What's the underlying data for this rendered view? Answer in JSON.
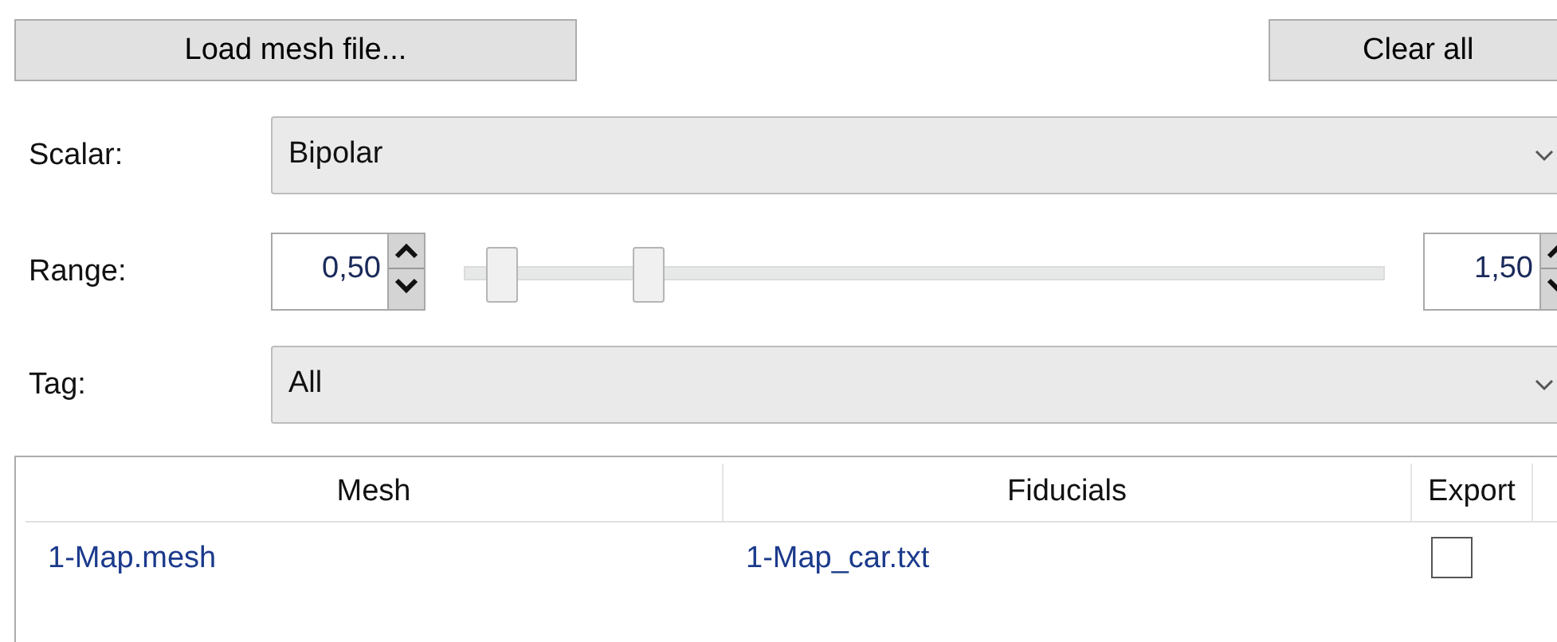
{
  "buttons": {
    "load": "Load mesh file...",
    "clear": "Clear all"
  },
  "scalar": {
    "label": "Scalar:",
    "value": "Bipolar"
  },
  "range": {
    "label": "Range:",
    "min_value": "0,50",
    "max_value": "1,50",
    "thumbs": [
      {
        "level": 0.04
      },
      {
        "level": 0.2
      }
    ]
  },
  "tag": {
    "label": "Tag:",
    "value": "All"
  },
  "table": {
    "columns": [
      "Mesh",
      "Fiducials",
      "Export"
    ],
    "rows": [
      {
        "mesh": "1-Map.mesh",
        "fiducials": "1-Map_car.txt",
        "export": false
      }
    ]
  }
}
